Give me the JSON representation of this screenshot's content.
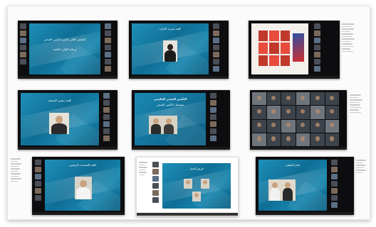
{
  "collage": {
    "screenshots": [
      {
        "slide_text": "الملتقى الثاني لإدارة التأمين الصحي",
        "slide_subtext": "برعاية الإدارة العامة"
      },
      {
        "slide_text": "كلمة مديرة الإدارة"
      },
      {
        "slide_text": ""
      },
      {
        "slide_text": "كلمة رئيس الجمعية"
      },
      {
        "slide_text": "التأمين الصحي الخليجي",
        "slide_subtext": "مستقبل التأمين الصحي"
      },
      {
        "slide_text": ""
      },
      {
        "slide_text": "كلمة المتحدث الرئيسي"
      },
      {
        "slide_text": "فريق العمل"
      },
      {
        "slide_text": "ختام الملتقى"
      }
    ]
  }
}
